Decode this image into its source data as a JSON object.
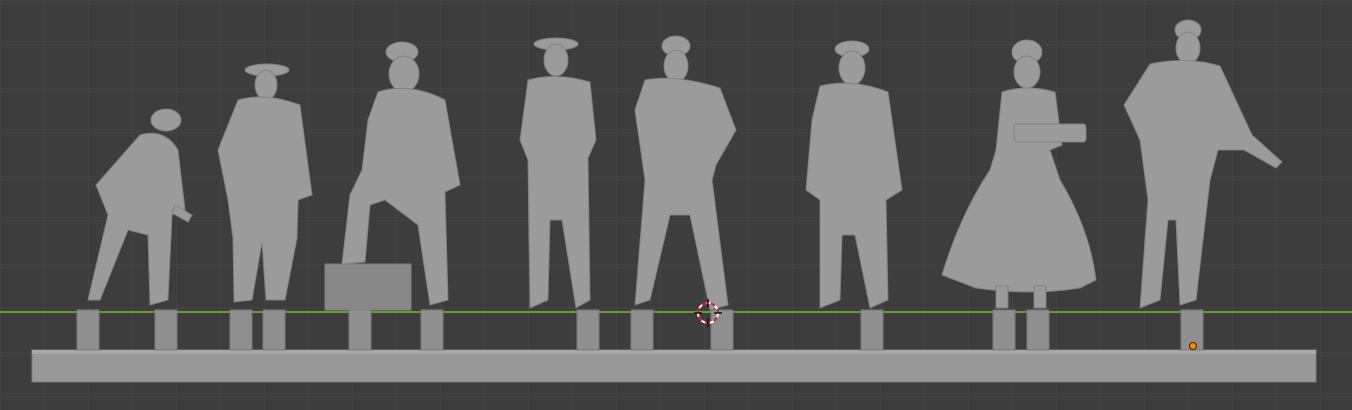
{
  "viewport": {
    "mode": "3D Viewport",
    "background": "#3d3d3d",
    "grid_color": "#4a4a4a",
    "horizon_color": "#6a9a2a",
    "model_color": "#9a9a9a",
    "origin_marker_color": "#ff8a00"
  },
  "figures": [
    {
      "name": "crouching-man"
    },
    {
      "name": "man-in-brimmed-hat-long-coat"
    },
    {
      "name": "seated-bearded-man-on-box"
    },
    {
      "name": "man-arms-crossed-hat"
    },
    {
      "name": "man-hand-on-chin-cap"
    },
    {
      "name": "man-in-flat-cap"
    },
    {
      "name": "woman-in-dress-holding-stack"
    },
    {
      "name": "man-pointing-in-cap"
    }
  ]
}
